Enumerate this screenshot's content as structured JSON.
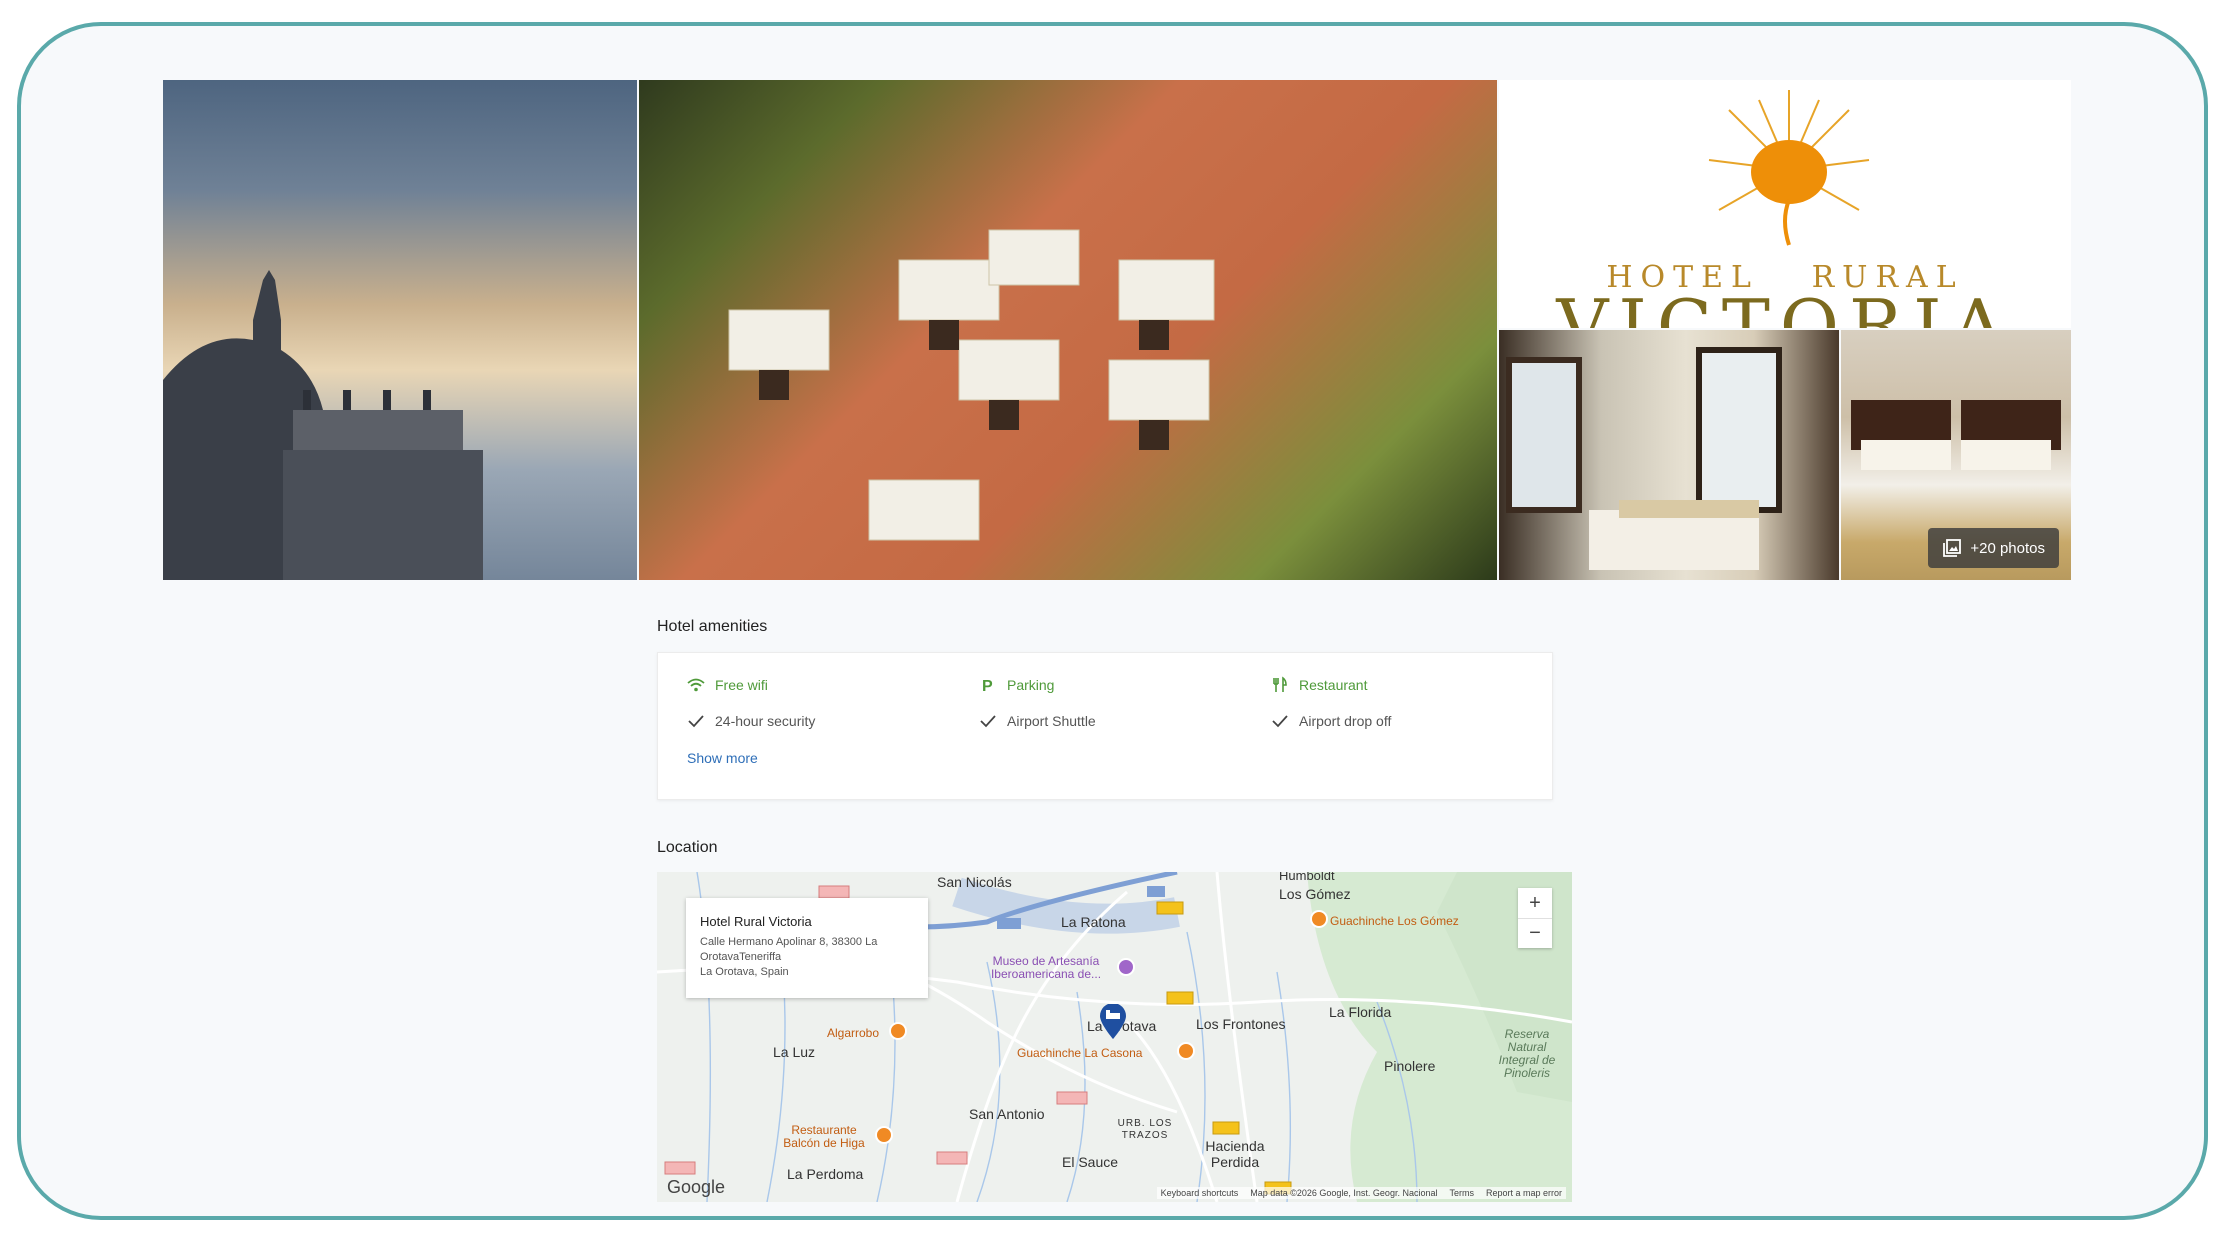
{
  "gallery": {
    "photo_count_label": "+20 photos",
    "logo_line1": "HOTEL   RURAL",
    "logo_line2": "VICTORIA"
  },
  "amenities": {
    "title": "Hotel amenities",
    "items": [
      {
        "label": "Free wifi",
        "icon": "wifi-icon",
        "highlight": true
      },
      {
        "label": "Parking",
        "icon": "parking-icon",
        "highlight": true
      },
      {
        "label": "Restaurant",
        "icon": "restaurant-icon",
        "highlight": true
      },
      {
        "label": "24-hour security",
        "icon": "check-icon",
        "highlight": false
      },
      {
        "label": "Airport Shuttle",
        "icon": "check-icon",
        "highlight": false
      },
      {
        "label": "Airport drop off",
        "icon": "check-icon",
        "highlight": false
      }
    ],
    "show_more": "Show more"
  },
  "location": {
    "title": "Location",
    "infobox": {
      "name": "Hotel Rural Victoria",
      "address_line1": "Calle Hermano Apolinar 8, 38300 La",
      "address_line2": "OrotavaTeneriffa",
      "address_line3": "La Orotava, Spain"
    },
    "places": {
      "san_nicolas": "San Nicolás",
      "humboldt": "Humboldt",
      "los_gomez": "Los Gómez",
      "la_ratona": "La Ratona",
      "la_orotava": "La Orotava",
      "los_frontones": "Los Frontones",
      "la_florida": "La Florida",
      "la_luz": "La Luz",
      "pinolere": "Pinolere",
      "san_antonio": "San Antonio",
      "urb_los_trazos": "URB. LOS TRAZOS",
      "hacienda_perdida": "Hacienda Perdida",
      "el_sauce": "El Sauce",
      "la_perdoma": "La Perdoma",
      "reserva": "Reserva Natural Integral de Pinoleris"
    },
    "pois": {
      "guachinche_gomez": "Guachinche Los Gómez",
      "museo": "Museo de Artesanía Iberoamericana de...",
      "algarrobo": "Algarrobo",
      "guachinche_casona": "Guachinche La Casona",
      "restaurante_higa": "Restaurante Balcón de Higa"
    },
    "zoom_in": "+",
    "zoom_out": "−",
    "google": "Google",
    "attribution": {
      "shortcuts": "Keyboard shortcuts",
      "map_data": "Map data ©2026 Google, Inst. Geogr. Nacional",
      "terms": "Terms",
      "report": "Report a map error"
    }
  },
  "colors": {
    "frame_border": "#5aa9aa",
    "amenity_green": "#4f9a3a",
    "link_blue": "#2f6fb8",
    "poi_orange": "#f08a24"
  }
}
